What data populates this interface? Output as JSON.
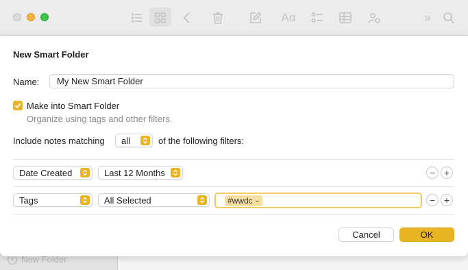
{
  "background": {
    "sidebar": {
      "new_folder_label": "New Folder"
    },
    "toolbar_icons": [
      "list-view-icon",
      "gallery-view-icon",
      "back-icon",
      "trash-icon",
      "compose-icon",
      "format-icon",
      "checklist-icon",
      "table-icon",
      "collaborate-icon",
      "more-icon",
      "search-icon"
    ]
  },
  "dialog": {
    "title": "New Smart Folder",
    "name_label": "Name:",
    "name_value": "My New Smart Folder",
    "make_smart_label": "Make into Smart Folder",
    "make_smart_checked": true,
    "make_smart_subtitle": "Organize using tags and other filters.",
    "include_label": "Include notes matching",
    "match_value": "all",
    "following_label": "of the following filters:",
    "filters": [
      {
        "field": "Date Created",
        "condition": "Last 12 Months",
        "value": ""
      },
      {
        "field": "Tags",
        "condition": "All Selected",
        "value": "#wwdc"
      }
    ],
    "remove_symbol": "−",
    "add_symbol": "+",
    "cancel_label": "Cancel",
    "ok_label": "OK"
  },
  "colors": {
    "accent": "#e8b422",
    "tag_token": "#f6dfa0",
    "focus_ring": "#f0c860"
  }
}
